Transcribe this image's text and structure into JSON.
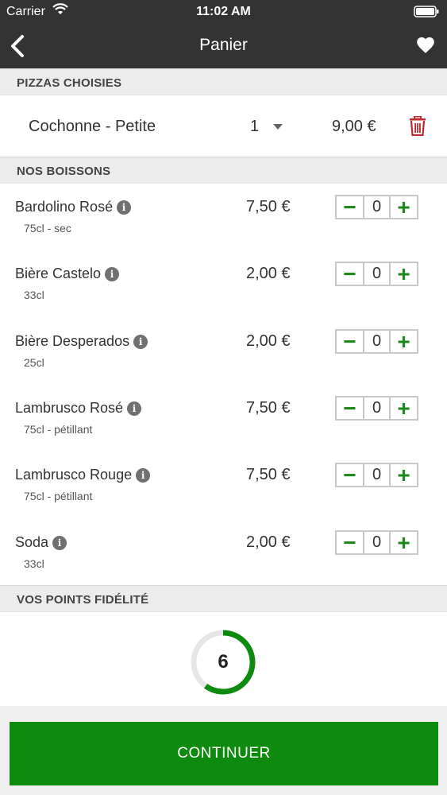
{
  "status_bar": {
    "carrier": "Carrier",
    "time": "11:02 AM"
  },
  "nav": {
    "title": "Panier",
    "back_icon": "chevron-left-icon",
    "favorite_icon": "heart-icon"
  },
  "sections": {
    "pizzas_header": "PIZZAS CHOISIES",
    "drinks_header": "NOS BOISSONS",
    "loyalty_header": "VOS POINTS FIDÉLITÉ"
  },
  "pizza": {
    "name": "Cochonne - Petite",
    "quantity": "1",
    "price": "9,00 €",
    "delete_color": "#c0282d"
  },
  "drinks": [
    {
      "name": "Bardolino Rosé",
      "desc": "75cl - sec",
      "price": "7,50 €",
      "qty": "0"
    },
    {
      "name": "Bière Castelo",
      "desc": "33cl",
      "price": "2,00 €",
      "qty": "0"
    },
    {
      "name": "Bière Desperados",
      "desc": "25cl",
      "price": "2,00 €",
      "qty": "0"
    },
    {
      "name": "Lambrusco Rosé",
      "desc": "75cl - pétillant",
      "price": "7,50 €",
      "qty": "0"
    },
    {
      "name": "Lambrusco Rouge",
      "desc": "75cl - pétillant",
      "price": "7,50 €",
      "qty": "0"
    },
    {
      "name": "Soda",
      "desc": "33cl",
      "price": "2,00 €",
      "qty": "0"
    }
  ],
  "stepper_symbols": {
    "minus": "−",
    "plus": "+"
  },
  "info_symbol": "i",
  "loyalty": {
    "points": "6",
    "progress": 0.6,
    "ring_color": "#0e8a0e",
    "track_color": "#e6e6e6"
  },
  "continue_label": "CONTINUER",
  "colors": {
    "header_bg": "#333333",
    "accent_green": "#0e8a0e"
  }
}
